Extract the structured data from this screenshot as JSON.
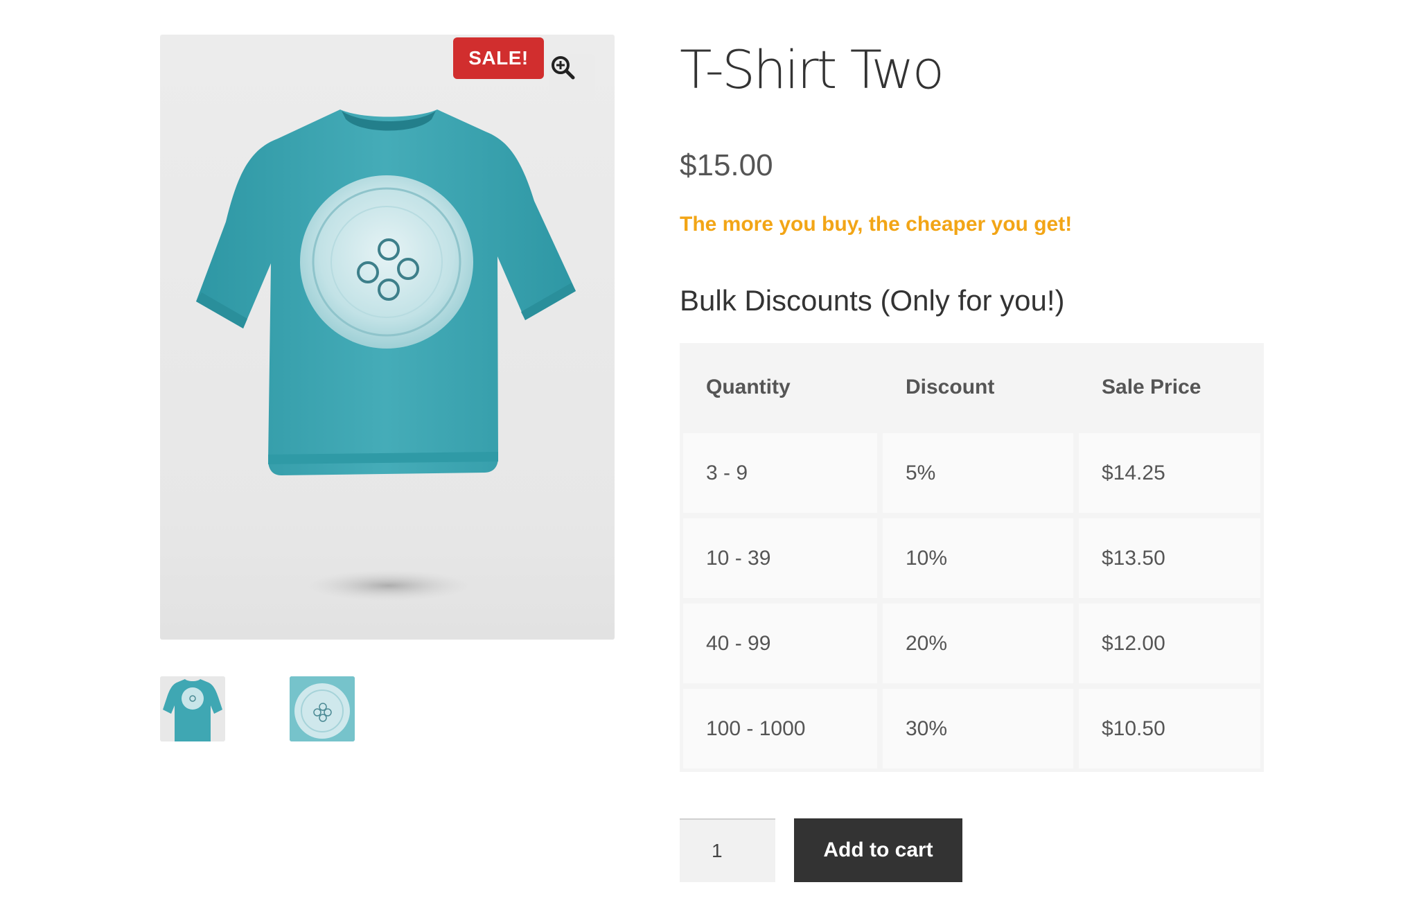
{
  "product": {
    "title": "T-Shirt Two",
    "price": "$15.00",
    "promo_text": "The more you buy, the cheaper you get!"
  },
  "gallery": {
    "sale_badge": "SALE!",
    "zoom_icon": "zoom-in-icon",
    "thumbnails": [
      "tshirt-front-thumbnail",
      "jellyfish-print-thumbnail"
    ]
  },
  "bulk_discounts": {
    "heading": "Bulk Discounts (Only for you!)",
    "columns": [
      "Quantity",
      "Discount",
      "Sale Price"
    ],
    "rows": [
      {
        "quantity": "3 - 9",
        "discount": "5%",
        "sale_price": "$14.25"
      },
      {
        "quantity": "10 - 39",
        "discount": "10%",
        "sale_price": "$13.50"
      },
      {
        "quantity": "40 - 99",
        "discount": "20%",
        "sale_price": "$12.00"
      },
      {
        "quantity": "100 - 1000",
        "discount": "30%",
        "sale_price": "$10.50"
      }
    ]
  },
  "cart": {
    "quantity_value": "1",
    "add_to_cart_label": "Add to cart"
  },
  "colors": {
    "sale_badge": "#d12e2e",
    "promo_text": "#f2a516",
    "button_bg": "#333333",
    "shirt": "#3fa7b3"
  }
}
